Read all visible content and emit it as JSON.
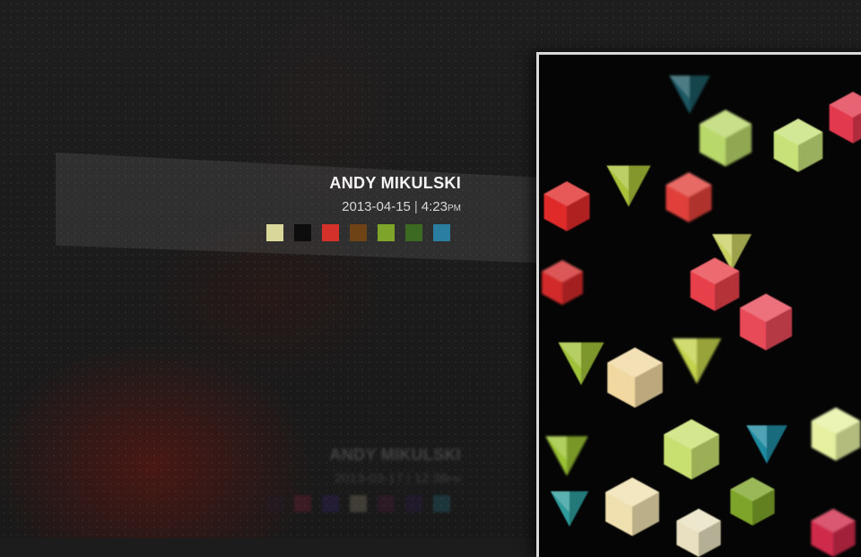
{
  "entries": [
    {
      "author": "ANDY MIKULSKI",
      "date": "2013-04-15",
      "separator": "|",
      "time": "4:23",
      "ampm": "PM",
      "palette": [
        "#d9d79a",
        "#0d0d0d",
        "#d3312a",
        "#6e4416",
        "#7ea52a",
        "#3d6a22",
        "#2a7ea0"
      ]
    },
    {
      "author": "ANDY MIKULSKI",
      "date": "2013-03-17",
      "separator": "|",
      "time": "12:38",
      "ampm": "PM",
      "palette": [
        "#281a3a",
        "#b0244e",
        "#4a2a9a",
        "#c8b89a",
        "#6a1a4a",
        "#3a1a6a",
        "#2a9ab0"
      ]
    }
  ],
  "artwork": {
    "gems": [
      {
        "shape": "hex",
        "color": "#b9d86a",
        "size": 66
      },
      {
        "shape": "hex",
        "color": "#c7e279",
        "size": 62
      },
      {
        "shape": "hex",
        "color": "#e2394f",
        "size": 60
      },
      {
        "shape": "tri",
        "color": "#1c5862",
        "size": 52
      },
      {
        "shape": "tri",
        "color": "#a8c23a",
        "size": 56
      },
      {
        "shape": "hex",
        "color": "#e02a2a",
        "size": 58
      },
      {
        "shape": "hex",
        "color": "#e1403a",
        "size": 58
      },
      {
        "shape": "tri",
        "color": "#c8d062",
        "size": 50
      },
      {
        "shape": "hex",
        "color": "#e8404a",
        "size": 62
      },
      {
        "shape": "hex",
        "color": "#d22a2a",
        "size": 52
      },
      {
        "shape": "hex",
        "color": "#e84a58",
        "size": 66
      },
      {
        "shape": "tri",
        "color": "#a0c23a",
        "size": 58
      },
      {
        "shape": "tri",
        "color": "#c3d24a",
        "size": 62
      },
      {
        "shape": "hex",
        "color": "#f0d8a0",
        "size": 70
      },
      {
        "shape": "hex",
        "color": "#c8e070",
        "size": 70
      },
      {
        "shape": "hex",
        "color": "#e6f0a0",
        "size": 62
      },
      {
        "shape": "tri",
        "color": "#1e8aa0",
        "size": 52
      },
      {
        "shape": "hex",
        "color": "#f0e0b0",
        "size": 68
      },
      {
        "shape": "tri",
        "color": "#9ac232",
        "size": 54
      },
      {
        "shape": "hex",
        "color": "#e8e0c0",
        "size": 56
      },
      {
        "shape": "tri",
        "color": "#2e9a9a",
        "size": 48
      },
      {
        "shape": "hex",
        "color": "#d02a4a",
        "size": 56
      },
      {
        "shape": "hex",
        "color": "#7ea52a",
        "size": 56
      }
    ]
  }
}
